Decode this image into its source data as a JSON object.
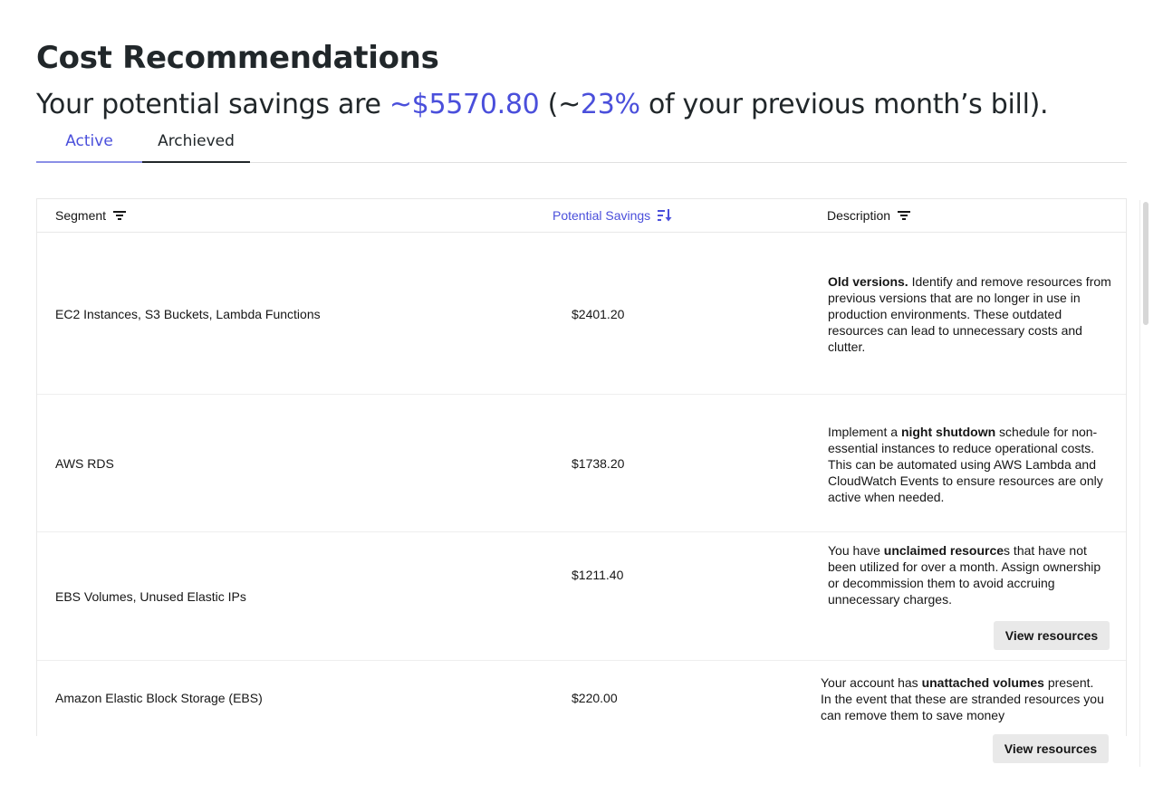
{
  "header": {
    "title": "Cost Recommendations",
    "summary_prefix": "Your potential savings are ",
    "summary_amount": "~$5570.80",
    "summary_mid": " (~",
    "summary_percent": "23%",
    "summary_suffix": " of your previous month’s bill)."
  },
  "tabs": [
    {
      "label": "Active",
      "selected": true
    },
    {
      "label": "Archieved",
      "selected": false
    }
  ],
  "table": {
    "columns": {
      "segment": "Segment",
      "savings": "Potential Savings",
      "description": "Description"
    },
    "rows": [
      {
        "segment": "EC2 Instances, S3 Buckets, Lambda Functions",
        "savings": "$2401.20",
        "desc_before": "",
        "desc_bold": "Old versions.",
        "desc_after": " Identify and remove resources from previous versions that are no longer in use in production environments. These outdated resources can lead to unnecessary costs and clutter.",
        "button": ""
      },
      {
        "segment": "AWS RDS",
        "savings": "$1738.20",
        "desc_before": "Implement a ",
        "desc_bold": "night shutdown",
        "desc_after": " schedule for non-essential instances to reduce operational costs. This can be automated using AWS Lambda and CloudWatch Events to ensure resources are only active when needed.",
        "button": ""
      },
      {
        "segment": "EBS Volumes, Unused Elastic IPs",
        "savings": "$1211.40",
        "desc_before": "You have ",
        "desc_bold": "unclaimed resource",
        "desc_after": "s that have not been utilized for over a month. Assign ownership or decommission them to avoid accruing unnecessary charges.",
        "button": "View resources"
      },
      {
        "segment": "Amazon Elastic Block Storage (EBS)",
        "savings": "$220.00",
        "desc_before": "Your account has ",
        "desc_bold": "unattached volumes",
        "desc_after": " present. In the event that these are stranded resources you can remove them to save money",
        "button": "View resources"
      }
    ]
  },
  "icons": {
    "filter": "filter-icon",
    "sort": "sort-descending-icon"
  },
  "colors": {
    "accent": "#4a4fdb",
    "button_bg": "#e9e9e9"
  }
}
